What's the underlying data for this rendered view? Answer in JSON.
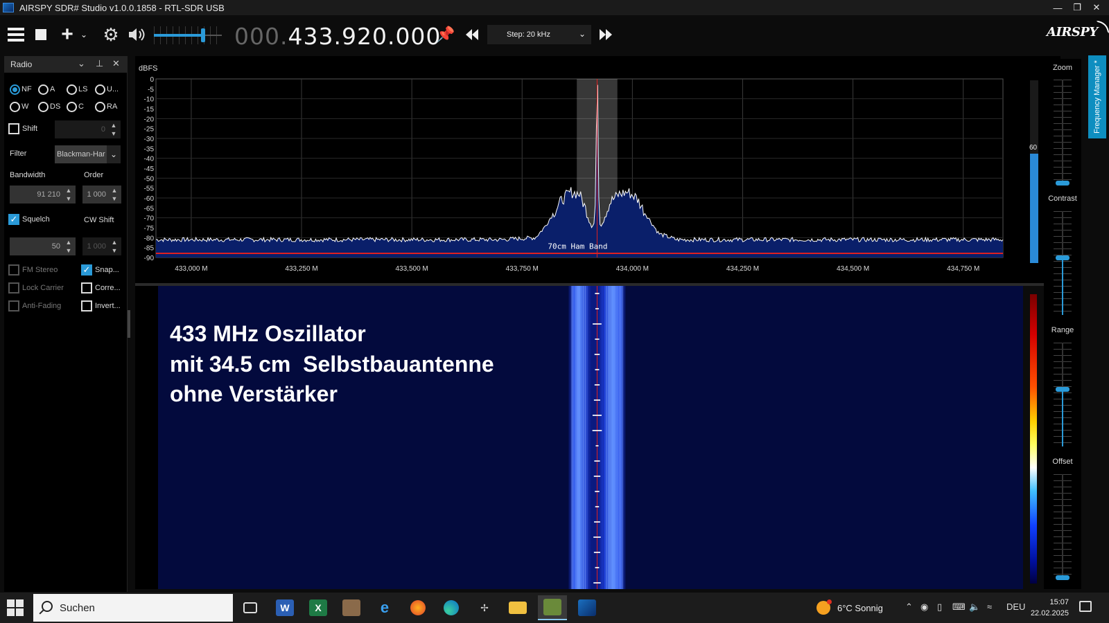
{
  "window": {
    "title": "AIRSPY SDR# Studio v1.0.0.1858 - RTL-SDR USB"
  },
  "toolbar": {
    "frequency_prefix": "000.",
    "frequency_main": "433.920.000",
    "step_label": "Step: 20 kHz",
    "volume_fraction": 0.72,
    "logo_text": "AIRSPY"
  },
  "radio_panel": {
    "title": "Radio",
    "modes_row1": [
      {
        "label": "NF",
        "selected": true
      },
      {
        "label": "A",
        "selected": false
      },
      {
        "label": "LS",
        "selected": false
      },
      {
        "label": "U...",
        "selected": false
      }
    ],
    "modes_row2": [
      {
        "label": "W",
        "selected": false
      },
      {
        "label": "DS",
        "selected": false
      },
      {
        "label": "C",
        "selected": false
      },
      {
        "label": "RA",
        "selected": false
      }
    ],
    "shift_label": "Shift",
    "shift_value": "0",
    "filter_label": "Filter",
    "filter_value": "Blackman-Har",
    "bandwidth_label": "Bandwidth",
    "bandwidth_value": "91 210",
    "order_label": "Order",
    "order_value": "1 000",
    "squelch_label": "Squelch",
    "squelch_value": "50",
    "cw_shift_label": "CW Shift",
    "cw_shift_value": "1 000",
    "fm_stereo_label": "FM Stereo",
    "snap_label": "Snap...",
    "lock_carrier_label": "Lock Carrier",
    "correct_label": "Corre...",
    "anti_fading_label": "Anti-Fading",
    "invert_label": "Invert..."
  },
  "spectrum": {
    "unit_label": "dBFS",
    "band_label": "70cm Ham Band",
    "level_value": "60",
    "level_fraction": 0.6
  },
  "overlay": {
    "line1": "433 MHz Oszillator",
    "line2": "mit 34.5 cm  Selbstbauantenne",
    "line3": "ohne Verstärker"
  },
  "right_panel": {
    "zoom_label": "Zoom",
    "contrast_label": "Contrast",
    "range_label": "Range",
    "offset_label": "Offset",
    "zoom_fraction": 0.0,
    "contrast_fraction": 0.55,
    "range_fraction": 0.55,
    "offset_fraction": 0.0,
    "frequency_manager_label": "Frequency Manager *"
  },
  "taskbar": {
    "search_placeholder": "Suchen",
    "weather_text": "6°C  Sonnig",
    "language": "DEU",
    "time": "15:07",
    "date": "22.02.2025"
  },
  "colors": {
    "accent": "#2a9ad8",
    "spectrum_line": "#ffffff",
    "spectrum_fill": "#0a1f6a",
    "marker_red": "#e02020",
    "waterfall_bg": "#030a3d"
  },
  "chart_data": {
    "type": "line",
    "title": "",
    "xlabel": "",
    "ylabel": "dBFS",
    "x_unit": "MHz",
    "xlim": [
      432.92,
      434.84
    ],
    "ylim": [
      -90,
      0
    ],
    "xticks": [
      433.0,
      433.25,
      433.5,
      433.75,
      434.0,
      434.25,
      434.5,
      434.75
    ],
    "xtick_labels": [
      "433,000 M",
      "433,250 M",
      "433,500 M",
      "433,750 M",
      "434,000 M",
      "434,250 M",
      "434,500 M",
      "434,750 M"
    ],
    "yticks": [
      0,
      -5,
      -10,
      -15,
      -20,
      -25,
      -30,
      -35,
      -40,
      -45,
      -50,
      -55,
      -60,
      -65,
      -70,
      -75,
      -80,
      -85,
      -90
    ],
    "grid": true,
    "center_frequency": 433.92,
    "filter_band": [
      433.874,
      433.966
    ],
    "series": [
      {
        "x": [
          432.92,
          433.1,
          433.3,
          433.5,
          433.7,
          433.78,
          433.8,
          433.82,
          433.84,
          433.86,
          433.88,
          433.895,
          433.905,
          433.915,
          433.92,
          433.925,
          433.935,
          433.95,
          433.97,
          433.99,
          434.01,
          434.03,
          434.06,
          434.1,
          434.3,
          434.5,
          434.7,
          434.84
        ],
        "y": [
          -81,
          -81,
          -81,
          -81,
          -81,
          -80,
          -75,
          -68,
          -61,
          -57,
          -58,
          -66,
          -72,
          -73,
          -3,
          -73,
          -70,
          -62,
          -58,
          -57,
          -60,
          -68,
          -78,
          -81,
          -81,
          -81,
          -81,
          -81
        ]
      }
    ]
  }
}
